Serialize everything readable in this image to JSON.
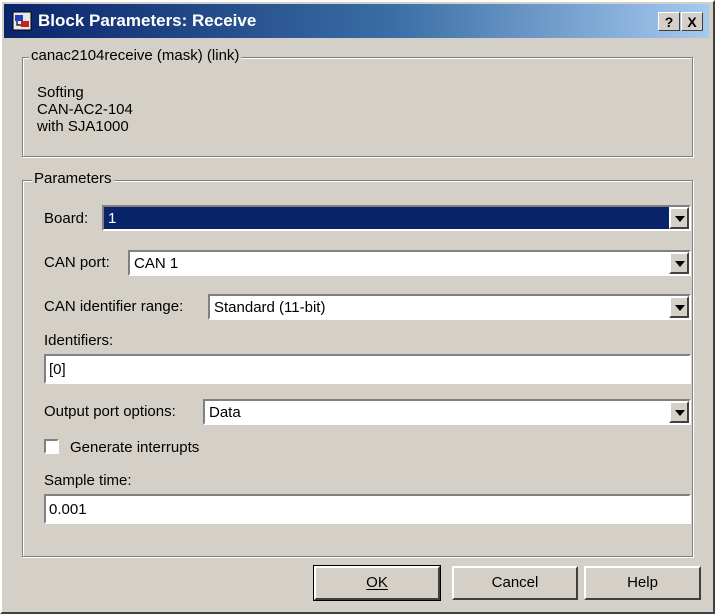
{
  "window": {
    "title": "Block Parameters: Receive",
    "help_button": "?",
    "close_button": "X"
  },
  "description": {
    "legend": "canac2104receive (mask) (link)",
    "lines": [
      "Softing",
      "CAN-AC2-104",
      "with SJA1000"
    ]
  },
  "parameters": {
    "legend": "Parameters",
    "board": {
      "label": "Board:",
      "value": "1"
    },
    "can_port": {
      "label": "CAN port:",
      "value": "CAN 1"
    },
    "id_range": {
      "label": "CAN identifier range:",
      "value": "Standard (11-bit)"
    },
    "identifiers": {
      "label": "Identifiers:",
      "value": "[0]"
    },
    "output_port": {
      "label": "Output port options:",
      "value": "Data"
    },
    "generate_interrupts": {
      "label": "Generate interrupts",
      "checked": false
    },
    "sample_time": {
      "label": "Sample time:",
      "value": "0.001"
    }
  },
  "buttons": {
    "ok": "OK",
    "cancel": "Cancel",
    "help": "Help"
  }
}
